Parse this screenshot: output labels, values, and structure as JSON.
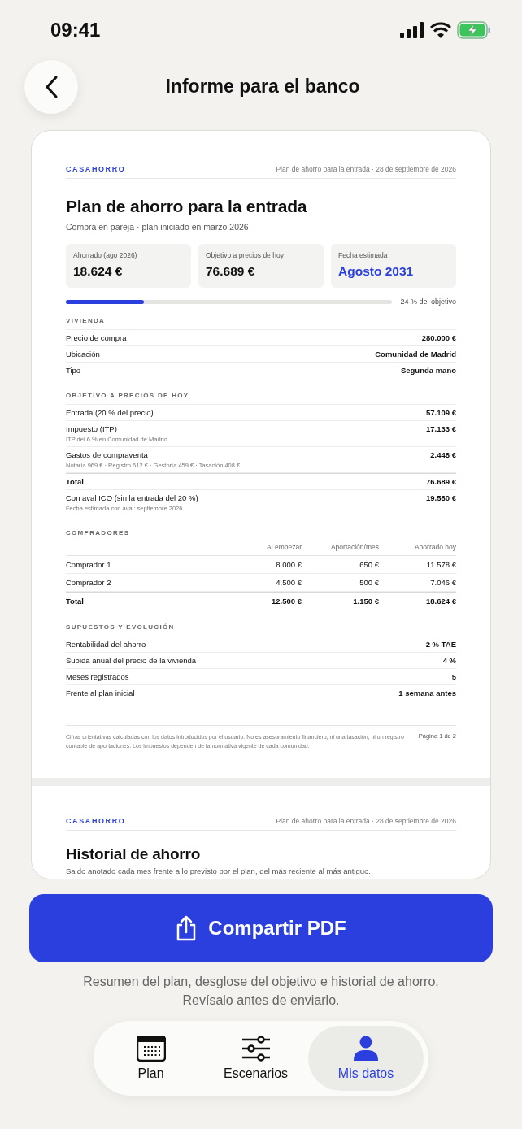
{
  "status_bar": {
    "time": "09:41"
  },
  "header": {
    "title": "Informe para el banco"
  },
  "report": {
    "pages": [
      {
        "brand": "CASAHORRO",
        "meta": "Plan de ahorro para la entrada · 28 de septiembre de 2026",
        "title": "Plan de ahorro para la entrada",
        "subtitle": "Compra en pareja · plan iniciado en marzo 2026",
        "stats": [
          {
            "label": "Ahorrado (ago 2026)",
            "value": "18.624 €",
            "accent": false
          },
          {
            "label": "Objetivo a precios de hoy",
            "value": "76.689 €",
            "accent": false
          },
          {
            "label": "Fecha estimada",
            "value": "Agosto 2031",
            "accent": true
          }
        ],
        "progress": {
          "level": 0.24,
          "label": "24 % del objetivo"
        },
        "sections": [
          {
            "kind": "list",
            "title": "VIVIENDA",
            "rows": [
              {
                "kind": "item",
                "label": "Precio de compra",
                "value": "280.000 €"
              },
              {
                "kind": "item",
                "label": "Ubicación",
                "value": "Comunidad de Madrid"
              },
              {
                "kind": "item",
                "label": "Tipo",
                "value": "Segunda mano"
              }
            ]
          },
          {
            "kind": "list",
            "title": "OBJETIVO A PRECIOS DE HOY",
            "rows": [
              {
                "kind": "item",
                "label": "Entrada (20 % del precio)",
                "value": "57.109 €"
              },
              {
                "kind": "item",
                "label": "Impuesto (ITP)",
                "note": "ITP del 6 % en Comunidad de Madrid",
                "value": "17.133 €"
              },
              {
                "kind": "item",
                "label": "Gastos de compraventa",
                "note": "Notaría 969 € · Registro 612 € · Gestoría 459 € · Tasación 408 €",
                "value": "2.448 €"
              },
              {
                "kind": "total",
                "label": "Total",
                "value": "76.689 €"
              },
              {
                "kind": "item",
                "label": "Con aval ICO (sin la entrada del 20 %)",
                "note": "Fecha estimada con aval: septiembre 2026",
                "value": "19.580 €"
              }
            ]
          },
          {
            "kind": "table",
            "title": "COMPRADORES",
            "columns": [
              "Al empezar",
              "Aportación/mes",
              "Ahorrado hoy"
            ],
            "rows": [
              {
                "kind": "item",
                "label": "Comprador 1",
                "cells": [
                  "8.000 €",
                  "650 €",
                  "11.578 €"
                ]
              },
              {
                "kind": "item",
                "label": "Comprador 2",
                "cells": [
                  "4.500 €",
                  "500 €",
                  "7.046 €"
                ]
              },
              {
                "kind": "total",
                "label": "Total",
                "cells": [
                  "12.500 €",
                  "1.150 €",
                  "18.624 €"
                ]
              }
            ]
          },
          {
            "kind": "list",
            "title": "SUPUESTOS Y EVOLUCIÓN",
            "rows": [
              {
                "kind": "item",
                "label": "Rentabilidad del ahorro",
                "value": "2 % TAE"
              },
              {
                "kind": "item",
                "label": "Subida anual del precio de la vivienda",
                "value": "4 %"
              },
              {
                "kind": "item",
                "label": "Meses registrados",
                "value": "5"
              },
              {
                "kind": "item",
                "label": "Frente al plan inicial",
                "value": "1 semana antes"
              }
            ]
          }
        ],
        "footer": {
          "note": "Cifras orientativas calculadas con los datos introducidos por el usuario. No es asesoramiento financiero, ni una tasación, ni un registro contable de aportaciones. Los impuestos dependen de la normativa vigente de cada comunidad.",
          "page": "Página 1 de 2"
        }
      },
      {
        "brand": "CASAHORRO",
        "meta": "Plan de ahorro para la entrada · 28 de septiembre de 2026",
        "title": "Historial de ahorro",
        "subtitle": "Saldo anotado cada mes frente a lo previsto por el plan, del más reciente al más antiguo."
      }
    ]
  },
  "share_button": {
    "label": "Compartir PDF"
  },
  "caption": [
    "Resumen del plan, desglose del objetivo e historial de ahorro.",
    "Revísalo antes de enviarlo."
  ],
  "tabs": [
    {
      "label": "Plan",
      "selected": false
    },
    {
      "label": "Escenarios",
      "selected": false
    },
    {
      "label": "Mis datos",
      "selected": true
    }
  ]
}
